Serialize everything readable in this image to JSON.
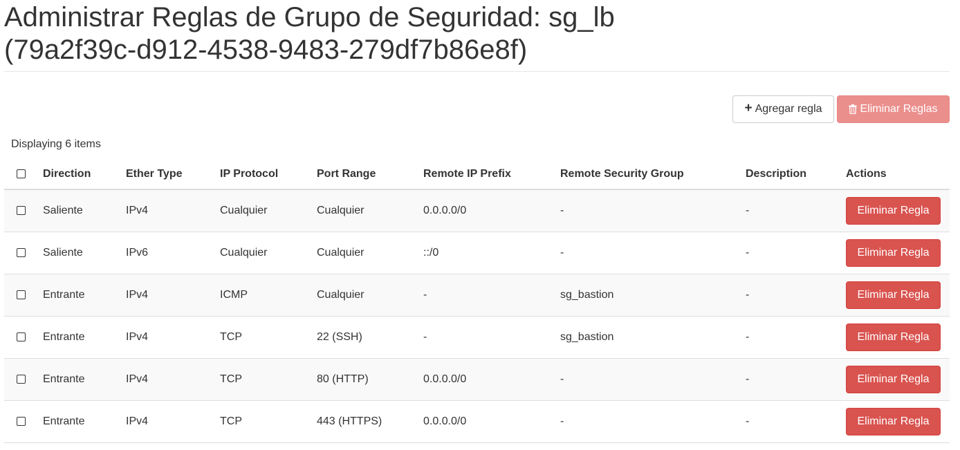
{
  "page": {
    "title_line1": "Administrar Reglas de Grupo de Seguridad: sg_lb",
    "title_line2": "(79a2f39c-d912-4538-9483-279df7b86e8f)"
  },
  "toolbar": {
    "add_label": "Agregar regla",
    "add_icon": "plus-icon",
    "delete_label": "Eliminar Reglas",
    "delete_icon": "trash-icon",
    "delete_disabled": true
  },
  "table": {
    "count_text": "Displaying 6 items",
    "columns": [
      "Direction",
      "Ether Type",
      "IP Protocol",
      "Port Range",
      "Remote IP Prefix",
      "Remote Security Group",
      "Description",
      "Actions"
    ],
    "rows": [
      {
        "direction": "Saliente",
        "ether_type": "IPv4",
        "ip_protocol": "Cualquier",
        "port_range": "Cualquier",
        "remote_ip_prefix": "0.0.0.0/0",
        "remote_security_group": "-",
        "description": "-",
        "action_label": "Eliminar Regla"
      },
      {
        "direction": "Saliente",
        "ether_type": "IPv6",
        "ip_protocol": "Cualquier",
        "port_range": "Cualquier",
        "remote_ip_prefix": "::/0",
        "remote_security_group": "-",
        "description": "-",
        "action_label": "Eliminar Regla"
      },
      {
        "direction": "Entrante",
        "ether_type": "IPv4",
        "ip_protocol": "ICMP",
        "port_range": "Cualquier",
        "remote_ip_prefix": "-",
        "remote_security_group": "sg_bastion",
        "description": "-",
        "action_label": "Eliminar Regla"
      },
      {
        "direction": "Entrante",
        "ether_type": "IPv4",
        "ip_protocol": "TCP",
        "port_range": "22 (SSH)",
        "remote_ip_prefix": "-",
        "remote_security_group": "sg_bastion",
        "description": "-",
        "action_label": "Eliminar Regla"
      },
      {
        "direction": "Entrante",
        "ether_type": "IPv4",
        "ip_protocol": "TCP",
        "port_range": "80 (HTTP)",
        "remote_ip_prefix": "0.0.0.0/0",
        "remote_security_group": "-",
        "description": "-",
        "action_label": "Eliminar Regla"
      },
      {
        "direction": "Entrante",
        "ether_type": "IPv4",
        "ip_protocol": "TCP",
        "port_range": "443 (HTTPS)",
        "remote_ip_prefix": "0.0.0.0/0",
        "remote_security_group": "-",
        "description": "-",
        "action_label": "Eliminar Regla"
      }
    ]
  },
  "colors": {
    "danger": "#d9534f",
    "danger_disabled": "#eb8f8d",
    "text": "#333333",
    "row_stripe": "#f9f9f9",
    "border": "#dddddd"
  }
}
